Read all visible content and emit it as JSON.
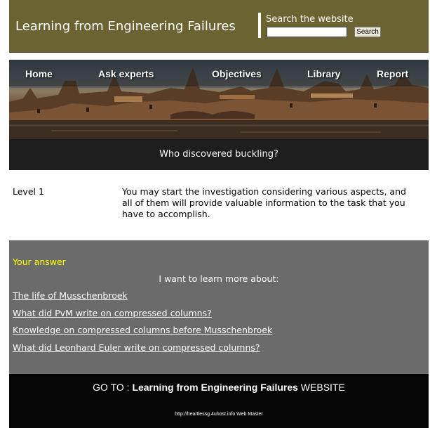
{
  "header": {
    "site_title": "Learning from Engineering Failures",
    "search_label": "Search the website",
    "search_value": "",
    "search_button": "Search"
  },
  "nav": {
    "items": [
      "Home",
      "Ask experts",
      "Objectives",
      "Library",
      "Report"
    ]
  },
  "page": {
    "title": "Who discovered buckling?"
  },
  "level": {
    "label": "Level 1",
    "text": "You may start the investigation considering various aspects, and all of them will provide valuable information to the task that you have to accomplish."
  },
  "answer": {
    "label": "Your answer",
    "prompt": "I want to learn more about:",
    "links": [
      "The life of Musschenbroek",
      "What did PvM write on compressed columns?",
      "Knowledge on compressed columns before Musschenbroek",
      "What did Leonhard Euler write on compressed columns?"
    ]
  },
  "footer": {
    "goto_prefix": "GO TO : ",
    "goto_site": "Learning from Engineering Failures",
    "goto_suffix": " WEBSITE",
    "credit": "http://heartlessg.4uhost.info Web Master"
  },
  "colors": {
    "header_bg": "#6b6332",
    "title_bar_bg": "#1e1e1e",
    "answer_bg": "#6b6b6b",
    "answer_label": "#ffff00",
    "footer_bg": "#050505"
  }
}
